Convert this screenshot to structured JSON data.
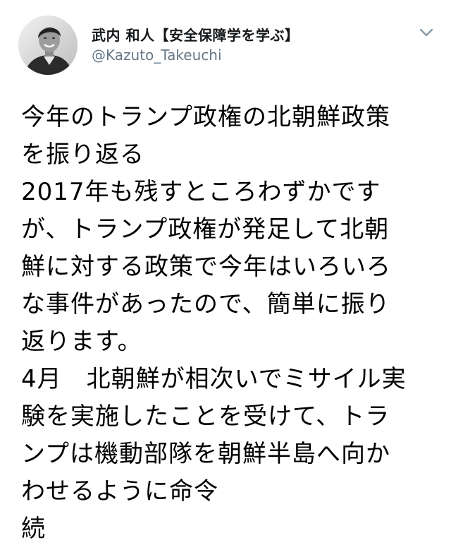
{
  "author": {
    "display_name": "武内 和人【安全保障学を学ぶ】",
    "handle": "@Kazuto_Takeuchi"
  },
  "icons": {
    "avatar": "profile-photo",
    "menu": "chevron-down-icon"
  },
  "colors": {
    "name": "#14171a",
    "handle": "#657786",
    "text": "#000000",
    "chevron": "#8899a6"
  },
  "tweet": {
    "lines": [
      "今年のトランプ政権の北朝鮮政策",
      "を振り返る",
      "2017年も残すところわずかです",
      "が、トランプ政権が発足して北朝",
      "鮮に対する政策で今年はいろいろ",
      "な事件があったので、簡単に振り",
      "返ります。",
      "4月　北朝鮮が相次いでミサイル実",
      "験を実施したことを受けて、トラ",
      "ンプは機動部隊を朝鮮半島へ向か",
      "わせるように命令",
      "続"
    ]
  }
}
